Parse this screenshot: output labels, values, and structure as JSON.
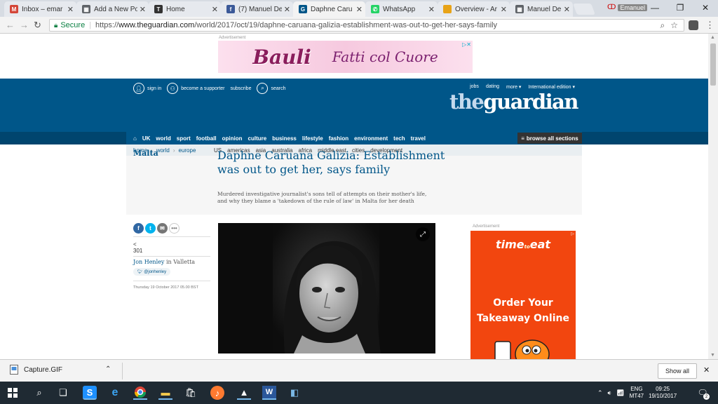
{
  "browser": {
    "tabs": [
      {
        "label": "Inbox – emar",
        "icon": "gmail-icon",
        "color": "#d44638"
      },
      {
        "label": "Add a New Po",
        "icon": "grid-icon",
        "color": "#5f6368"
      },
      {
        "label": "Home",
        "icon": "t-icon",
        "color": "#333333"
      },
      {
        "label": "(7) Manuel De",
        "icon": "facebook-icon",
        "color": "#3b5998"
      },
      {
        "label": "Daphne Caru",
        "icon": "guardian-icon",
        "color": "#005689"
      },
      {
        "label": "WhatsApp",
        "icon": "whatsapp-icon",
        "color": "#25d366"
      },
      {
        "label": "Overview - Ar",
        "icon": "folder-icon",
        "color": "#e8a317"
      },
      {
        "label": "Manuel Delia",
        "icon": "grid-icon",
        "color": "#5f6368"
      }
    ],
    "active_tab": 4,
    "profile_name": "Emanuel",
    "secure_label": "Secure",
    "url_prefix": "https://",
    "url_host": "www.theguardian.com",
    "url_path": "/world/2017/oct/19/daphne-caruana-galizia-establishment-was-out-to-get-her-says-family"
  },
  "ads": {
    "label": "Advertisement",
    "top_brand": "Bauli",
    "top_slogan": "Fatti col Cuore",
    "side_brand": "timeto eat",
    "side_brand_main": "time",
    "side_brand_small": "to",
    "side_brand_end": "eat",
    "side_copy_line1": "Order Your",
    "side_copy_line2": "Takeaway Online"
  },
  "guardian": {
    "top_links": {
      "sign_in": "sign in",
      "supporter": "become a supporter",
      "subscribe": "subscribe",
      "search": "search"
    },
    "right_links": [
      "jobs",
      "dating",
      "more ▾",
      "International edition ▾"
    ],
    "logo_the": "the",
    "logo_guardian": "guardian",
    "nav": [
      "UK",
      "world",
      "sport",
      "football",
      "opinion",
      "culture",
      "business",
      "lifestyle",
      "fashion",
      "environment",
      "tech",
      "travel"
    ],
    "browse_all": "browse all sections",
    "breadcrumbs": [
      "home",
      "world",
      "europe"
    ],
    "sub_links": [
      "US",
      "americas",
      "asia",
      "australia",
      "africa",
      "middle east",
      "cities",
      "development"
    ]
  },
  "article": {
    "section": "Malta",
    "headline": "Daphne Caruana Galizia: Establishment was out to get her, says family",
    "standfirst": "Murdered investigative journalist's sons tell of attempts on their mother's life, and why they blame a 'takedown of the rule of law' in Malta for her death",
    "share_count_icon": "<",
    "share_count": "301",
    "author": "Jon Henley",
    "author_in": "in Valletta",
    "twitter_handle": "@jonhenley",
    "published": "Thursday 19 October 2017 05.00 BST"
  },
  "downloads": {
    "file": "Capture.GIF",
    "show_all": "Show all"
  },
  "taskbar": {
    "lang_line1": "ENG",
    "lang_line2": "MT47",
    "time": "09:25",
    "date": "19/10/2017",
    "notifications": "2"
  }
}
